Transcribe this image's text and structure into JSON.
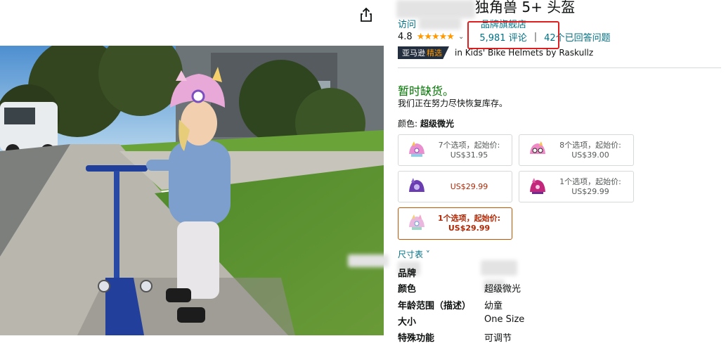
{
  "title": "独角兽 5+ 头盔",
  "store_link": "访问",
  "store_link_tail": "品牌旗舰店",
  "rating": {
    "value": "4.8",
    "stars": "★★★★★",
    "reviews": "5,981 评论",
    "separator": "|",
    "answered": "42个已回答问题"
  },
  "choice": {
    "badge_white": "亚马逊",
    "badge_orange": "精选",
    "text": "in Kids' Bike Helmets by Raskullz"
  },
  "stock": {
    "status": "暂时缺货。",
    "note": "我们正在努力尽快恢复库存。"
  },
  "color": {
    "label": "颜色:",
    "value": "超级微光"
  },
  "options": [
    {
      "line1": "7个选项，起始价:",
      "line2": "US$31.95"
    },
    {
      "line1": "8个选项，起始价:",
      "line2": "US$39.00"
    },
    {
      "solo": "US$29.99"
    },
    {
      "line1": "1个选项，起始价:",
      "line2": "US$29.99"
    },
    {
      "line1": "1个选项，起始价:",
      "line2": "US$29.99"
    }
  ],
  "size_chart": "尺寸表 ˅",
  "specs": [
    {
      "key": "品牌",
      "value": ""
    },
    {
      "key": "颜色",
      "value": "超级微光"
    },
    {
      "key": "年龄范围（描述）",
      "value": "幼童"
    },
    {
      "key": "大小",
      "value": "One Size"
    },
    {
      "key": "特殊功能",
      "value": "可调节"
    }
  ],
  "colors": {
    "link": "#007185",
    "in_stock": "#007600",
    "price": "#b12704",
    "star": "#ff9900",
    "highlight_box": "#e02020",
    "selected_border": "#c45500"
  },
  "icons": [
    "share-icon",
    "star-icon",
    "chevron-down-icon"
  ]
}
